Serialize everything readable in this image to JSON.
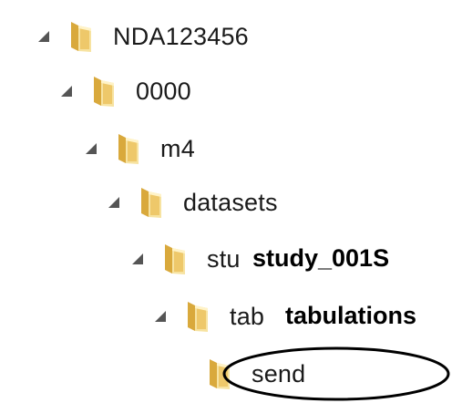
{
  "tree": {
    "nodes": [
      {
        "label": "NDA123456",
        "expanded": true,
        "icon": "folder-icon",
        "expander_icon": "expanded-triangle-icon"
      },
      {
        "label": "0000",
        "expanded": true,
        "icon": "folder-icon",
        "expander_icon": "expanded-triangle-icon"
      },
      {
        "label": "m4",
        "expanded": true,
        "icon": "folder-icon",
        "expander_icon": "expanded-triangle-icon"
      },
      {
        "label": "datasets",
        "expanded": true,
        "icon": "folder-icon",
        "expander_icon": "expanded-triangle-icon"
      },
      {
        "label": "stu",
        "expanded": true,
        "icon": "folder-icon",
        "expander_icon": "expanded-triangle-icon"
      },
      {
        "label": "tab",
        "expanded": true,
        "icon": "folder-icon",
        "expander_icon": "expanded-triangle-icon"
      },
      {
        "label": "send",
        "expanded": false,
        "icon": "folder-icon"
      }
    ]
  },
  "overlays": {
    "study": "study_001S",
    "tabulations": "tabulations"
  },
  "colors": {
    "folder_light": "#f7e3a1",
    "folder_mid": "#eec86a",
    "folder_dark": "#d9a93c",
    "expander": "#555555",
    "highlight_ring": "#000000"
  }
}
